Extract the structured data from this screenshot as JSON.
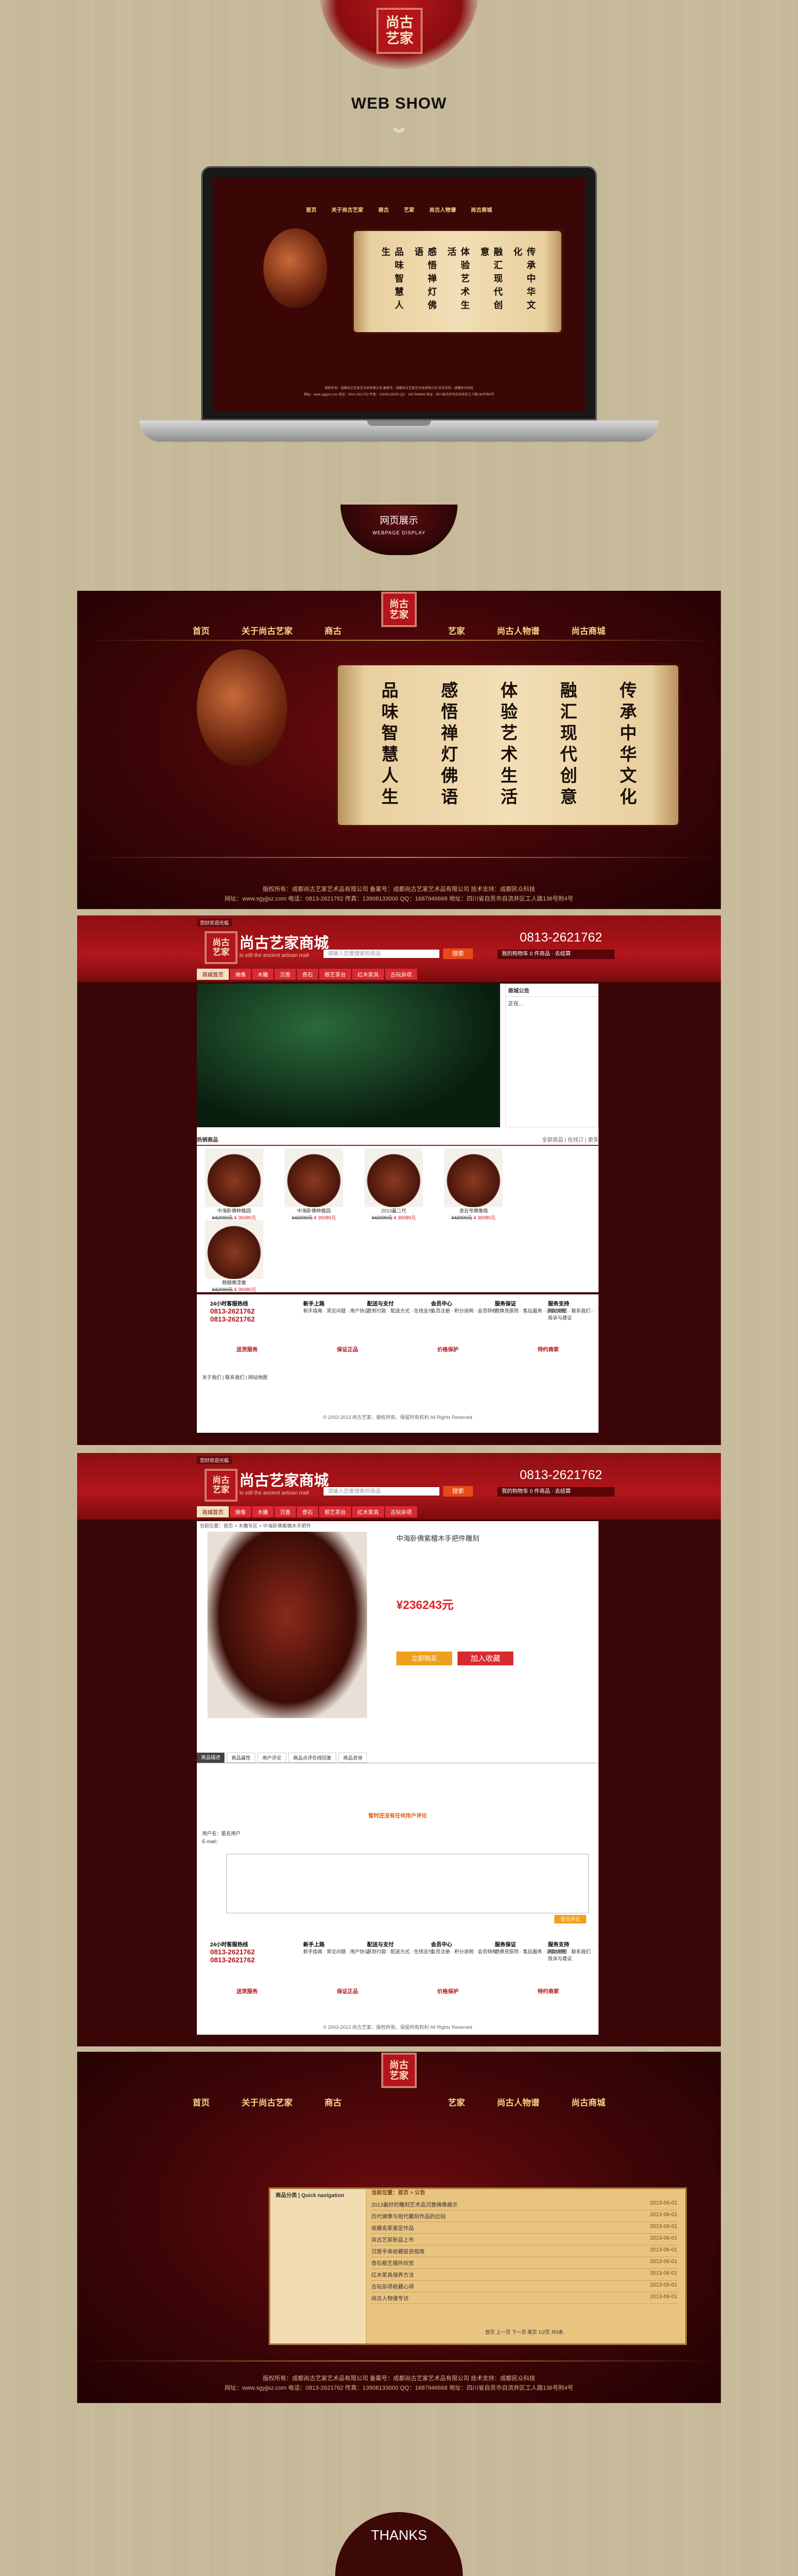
{
  "logo": {
    "seal_text": "尚古\n艺家"
  },
  "header": {
    "title": "WEB SHOW",
    "chevron": "︾"
  },
  "badge": {
    "title": "网页展示",
    "subtitle": "WEBPAGE DISPLAY"
  },
  "site_nav": [
    "首页",
    "关于尚古艺家",
    "商古",
    "艺家",
    "尚古人物谱",
    "尚古商城"
  ],
  "scroll_text": [
    "传承中华文化",
    "融汇现代创意",
    "体验艺术生活",
    "感悟禅灯佛语",
    "品味智慧人生"
  ],
  "home_footer": {
    "line1": "版权所有：成都尚古艺家艺术品有限公司 备案号：成都尚古艺家艺术品有限公司 技术支持：成都民众科技",
    "line2": "网址：www.sgyjjsz.com 电话：0813-2621762 传真：13908133000 QQ：1687946668 地址：四川省自贡市自流井区工人路136号附4号"
  },
  "shop": {
    "top_note": "您好欢迎光临",
    "logo_name": "尚古艺家商城",
    "logo_sub": "Is still the ancient artisan mall",
    "search_placeholder": "请输入您要搜索的商品",
    "search_button": "搜索",
    "phone": "0813-2621762",
    "cart": "我的购物车 0 件商品 · 去结算",
    "nav": [
      "商城首页",
      "佛像",
      "木雕",
      "沉香",
      "奇石",
      "根艺茶台",
      "红木家具",
      "古玩杂项"
    ],
    "notice_title": "商城公告",
    "notice_body": "正在...",
    "hot_title": "热销商品",
    "hot_more": "全部商品 | 在线订 | 更多",
    "products": [
      {
        "name": "中海卧佛种植园",
        "price": "¥ 36080元",
        "old": "¥42000元"
      },
      {
        "name": "中海卧佛种植园",
        "price": "¥ 36080元",
        "old": "¥42000元"
      },
      {
        "name": "2013最二代",
        "price": "¥ 36080元",
        "old": "¥42000元"
      },
      {
        "name": "清云号佛像缩",
        "price": "¥ 36080元",
        "old": "¥42000元"
      },
      {
        "name": "精细佛漆像",
        "price": "¥ 36080元",
        "old": "¥42000元"
      }
    ],
    "hotline_label": "24小时客服热线",
    "hotline": "0813-2621762",
    "hotline2": "0813-2621762",
    "services": [
      {
        "title": "新手上路",
        "items": "新手指南 · 常见问题 · 用户协议"
      },
      {
        "title": "配送与支付",
        "items": "货到付款 · 配送方式 · 在线支付"
      },
      {
        "title": "会员中心",
        "items": "会员注册 · 积分说明 · 会员特权"
      },
      {
        "title": "服务保证",
        "items": "退换货原则 · 售后服务 · 退款说明"
      },
      {
        "title": "服务支持",
        "items": "网站地图 · 联系我们 · 投诉与建议"
      }
    ],
    "badges": [
      "送货服务",
      "保证正品",
      "价格保护",
      "特约商家"
    ],
    "bottom_links": "关于我们 | 联系我们 | 网站地图",
    "copyright": "© 2003-2013 尚古艺家，版权所有，保留所有权利 All Rights Reserved"
  },
  "detail": {
    "breadcrumb": "当前位置：首页 > 木雕专区 > 中海卧佛紫檀木手把件",
    "title": "中海卧佛紫檀木手把件雕刻",
    "price": "¥236243元",
    "buy": "立即购买",
    "add_cart": "加入收藏",
    "tabs": [
      "商品描述",
      "商品属性",
      "用户评论",
      "商品点评在线回复",
      "商品咨询"
    ],
    "review_title": "暂时还没有任何用户评论",
    "submit": "提交评论",
    "user_label": "用户名：匿名用户",
    "email_label": "E-mail："
  },
  "navpage": {
    "left_title": "商品分类 | Quick navigation",
    "right_title": "当前位置：首页 > 公告",
    "items": [
      {
        "text": "2013最好的雕刻艺术品沉香佛像展示",
        "date": "2013-06-01"
      },
      {
        "text": "历代佛像与现代雕刻作品的比较",
        "date": "2013-06-01"
      },
      {
        "text": "收藏名家鉴定作品",
        "date": "2013-06-01"
      },
      {
        "text": "尚古艺家新品上市",
        "date": "2013-06-01"
      },
      {
        "text": "沉香手串收藏投资指南",
        "date": "2013-06-01"
      },
      {
        "text": "奇石根艺摆件欣赏",
        "date": "2013-06-01"
      },
      {
        "text": "红木家具保养方法",
        "date": "2013-06-01"
      },
      {
        "text": "古玩杂项收藏心得",
        "date": "2013-06-01"
      },
      {
        "text": "尚古人物谱专访",
        "date": "2013-06-01"
      }
    ],
    "pager": "首页 上一页 下一页 尾页 1/2页 共9条"
  },
  "thanks": "THANKS"
}
